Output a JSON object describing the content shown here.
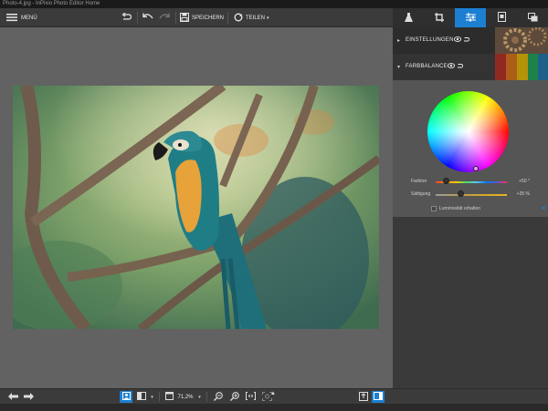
{
  "window": {
    "title": "Photo-4.jpg - InPixio Photo Editor Home"
  },
  "toolbar": {
    "menu_label": "MENÜ",
    "save_label": "SPEICHERN",
    "share_label": "TEILEN",
    "share_arrow": "▾"
  },
  "panel": {
    "einstellungen_label": "EINSTELLUNGEN",
    "farbbalance_label": "FARBBALANCE",
    "sliders": {
      "farbton": {
        "label": "Farbton",
        "value_text": "+50 °",
        "value": 50
      },
      "saettigung": {
        "label": "Sättigung",
        "value_text": "+35 %",
        "value": 35
      }
    },
    "luminosity_label": "Luminosität erhalten",
    "luminosity_checked": false
  },
  "bottombar": {
    "zoom_value": "71,2%",
    "zoom_arrow": "▾"
  },
  "colors": {
    "accent": "#1d7fd1",
    "canvas": "#626262",
    "toolbar": "#3b3b3b",
    "panel": "#3a3a3a"
  },
  "icons": [
    "menu-icon",
    "reset-icon",
    "undo-icon",
    "redo-icon",
    "save-icon",
    "share-icon",
    "flask-icon",
    "crop-icon",
    "sliders-icon",
    "frame-icon",
    "layers-icon",
    "eye-icon",
    "prev-icon",
    "next-icon",
    "single-view-icon",
    "compare-view-icon",
    "fit-screen-icon",
    "zoom-out-icon",
    "zoom-in-icon",
    "actual-size-icon",
    "zoom-fit-icon",
    "export-icon",
    "panel-toggle-icon"
  ]
}
